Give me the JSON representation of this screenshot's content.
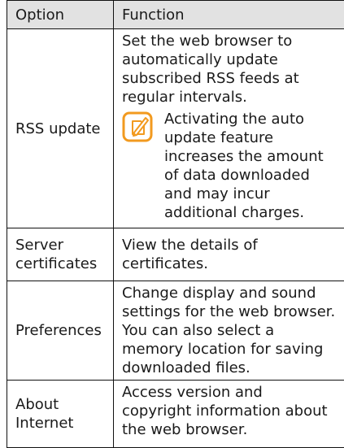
{
  "table": {
    "headers": {
      "option": "Option",
      "function": "Function"
    },
    "rows": [
      {
        "option": "RSS update",
        "function": "Set the web browser to automatically update subscribed RSS feeds at regular intervals.",
        "note": "Activating the auto update feature increases the amount of data downloaded and may incur additional charges.",
        "note_icon": "note-pencil-icon"
      },
      {
        "option": "Server certificates",
        "function": "View the details of certificates."
      },
      {
        "option": "Preferences",
        "function": "Change display and sound settings for the web browser. You can also select a memory location for saving downloaded files."
      },
      {
        "option": "About Internet",
        "function": "Access version and copyright information about the web browser."
      }
    ]
  },
  "colors": {
    "header_bg": "#e2e2e2",
    "border": "#111111",
    "note_icon": "#f29a1f"
  }
}
